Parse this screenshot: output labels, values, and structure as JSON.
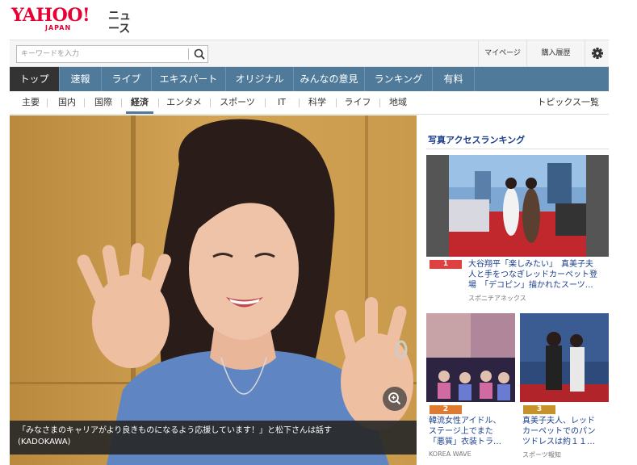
{
  "header": {
    "logo_yahoo": "YAHOO!",
    "logo_japan": "JAPAN",
    "logo_news": "ニュース"
  },
  "search": {
    "placeholder": "キーワードを入力",
    "icon": "search-icon"
  },
  "top_links": {
    "mypage": "マイページ",
    "history": "購入履歴",
    "settings_icon": "gear-icon"
  },
  "main_nav": [
    {
      "label": "トップ"
    },
    {
      "label": "速報"
    },
    {
      "label": "ライブ"
    },
    {
      "label": "エキスパート"
    },
    {
      "label": "オリジナル"
    },
    {
      "label": "みんなの意見"
    },
    {
      "label": "ランキング"
    },
    {
      "label": "有料"
    }
  ],
  "sub_nav": [
    {
      "label": "主要"
    },
    {
      "label": "国内"
    },
    {
      "label": "国際"
    },
    {
      "label": "経済"
    },
    {
      "label": "エンタメ"
    },
    {
      "label": "スポーツ"
    },
    {
      "label": "IT"
    },
    {
      "label": "科学"
    },
    {
      "label": "ライフ"
    },
    {
      "label": "地域"
    }
  ],
  "topics_all": "トピックス一覧",
  "photo": {
    "caption_line1": "「みなさまのキャリアがより良きものになるよう応援しています！」と松下さんは話す",
    "caption_line2": "(KADOKAWA)",
    "zoom_icon": "zoom-in-icon"
  },
  "ranking": {
    "title": "写真アクセスランキング",
    "items": [
      {
        "rank": "1",
        "line1": "大谷翔平「楽しみたい」　真美子夫",
        "line2": "人と手をつなぎレッドカーペット登",
        "line3": "場　「デコピン」描かれたスーツ…",
        "source": "スポニチアネックス"
      },
      {
        "rank": "2",
        "line1": "韓流女性アイドル、",
        "line2": "ステージ上でまた",
        "line3": "「悪質」衣装トラ…",
        "source": "KOREA WAVE"
      },
      {
        "rank": "3",
        "line1": "真美子夫人、レッド",
        "line2": "カーペットでのパン",
        "line3": "ツドレスは約１１…",
        "source": "スポーツ報知"
      }
    ],
    "badge_colors": {
      "r1": "#e04040",
      "r2": "#e07a30",
      "r3": "#c8922a"
    }
  },
  "colors": {
    "nav_bg": "#4f7a9a",
    "nav_active": "#333333",
    "link": "#1a3e8c",
    "brand_red": "#e60033"
  }
}
